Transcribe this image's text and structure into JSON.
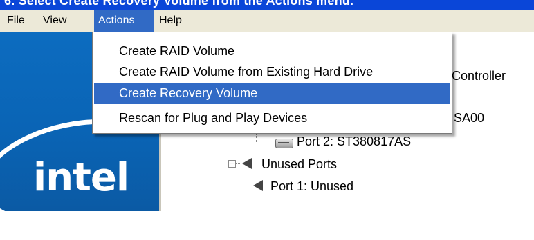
{
  "title_strip": {
    "text": "6. Select Create Recovery Volume from the Actions menu."
  },
  "menubar": {
    "items": [
      {
        "label": "File"
      },
      {
        "label": "View"
      },
      {
        "label": "Actions"
      },
      {
        "label": "Help"
      }
    ],
    "active": "Actions"
  },
  "actions_menu": {
    "items": [
      {
        "label": "Create RAID Volume"
      },
      {
        "label": "Create RAID Volume from Existing Hard Drive"
      },
      {
        "label": "Create Recovery Volume"
      },
      {
        "label": "Rescan for Plug and Play Devices"
      }
    ],
    "highlighted": "Create Recovery Volume"
  },
  "logo": {
    "text": "intel"
  },
  "tree": {
    "controller_fragment": "Controller",
    "drive_fragment": "SA00",
    "port2_label": "Port 2: ST380817AS",
    "unused_ports_label": "Unused Ports",
    "port1_label": "Port 1: Unused",
    "expander_symbol": "−"
  },
  "colors": {
    "accent": "#316ac5",
    "menubar_bg": "#ece9d8",
    "intel_blue": "#0a64b5",
    "title_blue": "#0a46d8"
  },
  "icons": {
    "disk": "hard-drive-icon",
    "port": "port-connector-icon",
    "unused": "unused-ports-icon"
  }
}
